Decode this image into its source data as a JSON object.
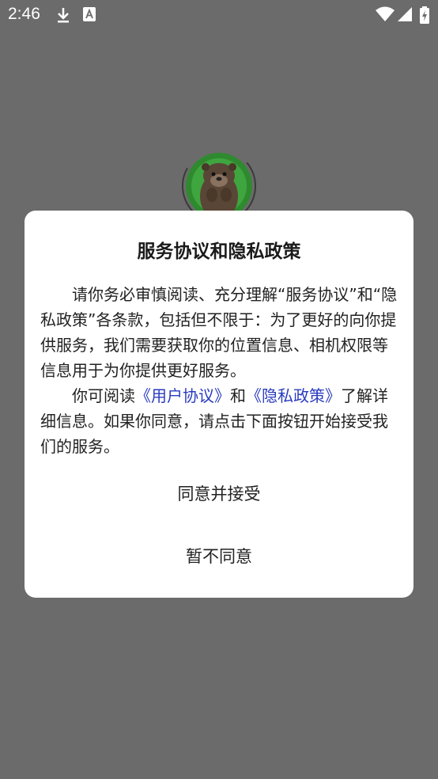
{
  "status_bar": {
    "time": "2:46",
    "icons": [
      "download-icon",
      "a-badge-icon",
      "wifi-icon",
      "signal-icon",
      "battery-icon"
    ]
  },
  "dialog": {
    "title": "服务协议和隐私政策",
    "paragraph1": "请你务必审慎阅读、充分理解“服务协议”和“隐私政策”各条款，包括但不限于：为了更好的向你提供服务，我们需要获取你的位置信息、相机权限等信息用于为你提供更好服务。",
    "paragraph2_prefix": "你可阅读",
    "user_agreement_link": "《用户协议》",
    "paragraph2_and": "和",
    "privacy_policy_link": "《隐私政策》",
    "paragraph2_suffix": "了解详细信息。如果你同意，请点击下面按钮开始接受我们的服务。",
    "agree_button": "同意并接受",
    "disagree_button": "暂不同意"
  },
  "colors": {
    "overlay": "#6b6b6b",
    "link": "#2a3bc0",
    "dialog_bg": "#ffffff"
  }
}
